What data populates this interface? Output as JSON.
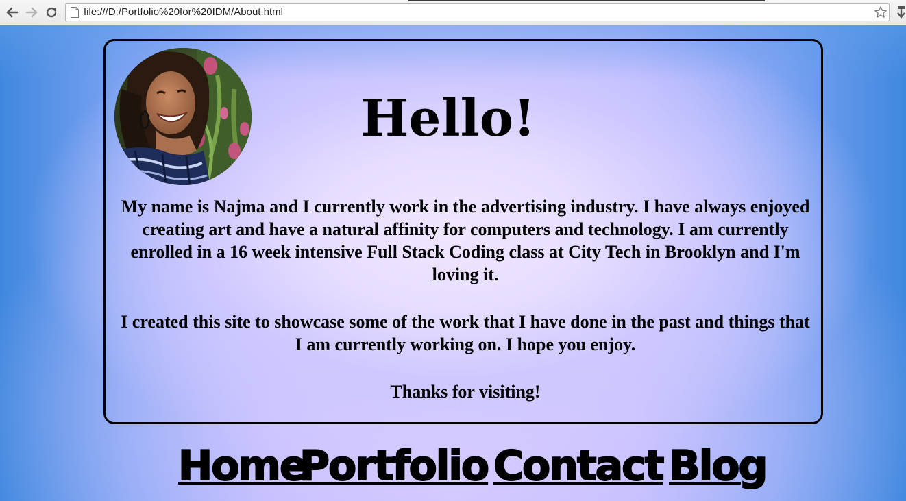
{
  "browser": {
    "url": "file:///D:/Portfolio%20for%20IDM/About.html"
  },
  "page": {
    "heading": "Hello!",
    "paragraphs": [
      "My name is Najma and I currently work in the advertising industry. I have always enjoyed creating art and have a natural affinity for computers and technology. I am currently enrolled in a 16 week intensive Full Stack Coding class at City Tech in Brooklyn and I'm loving it.",
      "I created this site to showcase some of the work that I have done in the past and things that I am currently working on. I hope you enjoy.",
      "Thanks for visiting!"
    ],
    "nav": [
      {
        "label": "Home"
      },
      {
        "label": "Portfolio"
      },
      {
        "label": "Contact"
      },
      {
        "label": "Blog"
      }
    ]
  },
  "icons": [
    "back-arrow-icon",
    "forward-arrow-icon",
    "reload-icon",
    "page-icon",
    "star-icon"
  ]
}
